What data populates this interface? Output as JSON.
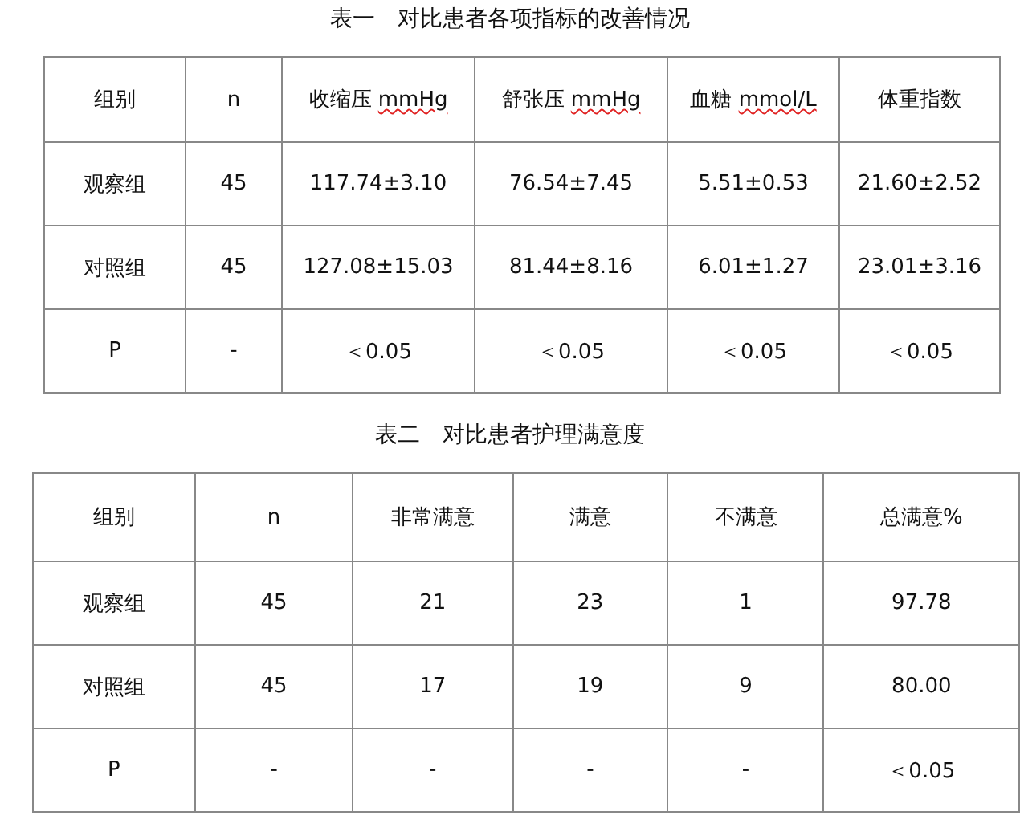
{
  "tables": [
    {
      "title": "表一　对比患者各项指标的改善情况",
      "columns": [
        {
          "label": "组别"
        },
        {
          "label": "n"
        },
        {
          "label": "收缩压 ",
          "unit": "mmHg"
        },
        {
          "label": "舒张压 ",
          "unit": "mmHg"
        },
        {
          "label": "血糖 ",
          "unit": "mmol/L"
        },
        {
          "label": "体重指数"
        }
      ],
      "rows": [
        [
          "观察组",
          "45",
          "117.74±3.10",
          "76.54±7.45",
          "5.51±0.53",
          "21.60±2.52"
        ],
        [
          "对照组",
          "45",
          "127.08±15.03",
          "81.44±8.16",
          "6.01±1.27",
          "23.01±3.16"
        ],
        [
          "P",
          "-",
          "＜0.05",
          "＜0.05",
          "＜0.05",
          "＜0.05"
        ]
      ]
    },
    {
      "title": "表二　对比患者护理满意度",
      "columns": [
        {
          "label": "组别"
        },
        {
          "label": "n"
        },
        {
          "label": "非常满意"
        },
        {
          "label": "满意"
        },
        {
          "label": "不满意"
        },
        {
          "label": "总满意%"
        }
      ],
      "rows": [
        [
          "观察组",
          "45",
          "21",
          "23",
          "1",
          "97.78"
        ],
        [
          "对照组",
          "45",
          "17",
          "19",
          "9",
          "80.00"
        ],
        [
          "P",
          "-",
          "-",
          "-",
          "-",
          "＜0.05"
        ]
      ]
    }
  ]
}
